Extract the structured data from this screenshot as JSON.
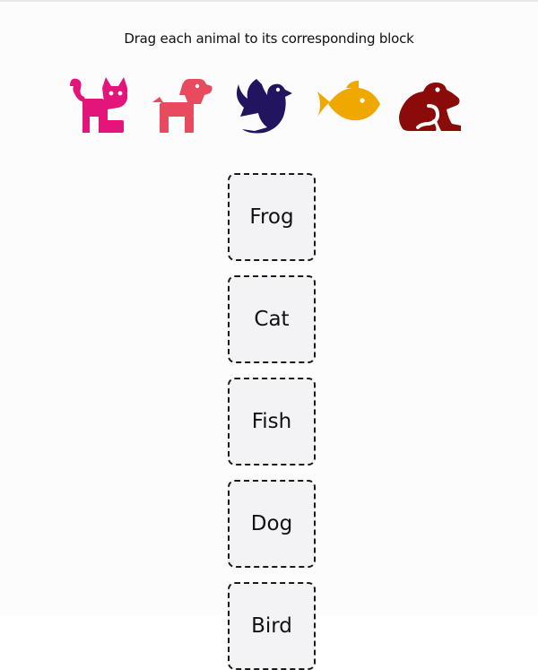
{
  "instruction": "Drag each animal to its corresponding block",
  "animals": [
    {
      "icon": "cat-icon",
      "color": "#e3147a"
    },
    {
      "icon": "dog-icon",
      "color": "#e84a5f"
    },
    {
      "icon": "bird-icon",
      "color": "#22145e"
    },
    {
      "icon": "fish-icon",
      "color": "#eea800"
    },
    {
      "icon": "frog-icon",
      "color": "#8b0a0a"
    }
  ],
  "blocks": [
    {
      "label": "Frog"
    },
    {
      "label": "Cat"
    },
    {
      "label": "Fish"
    },
    {
      "label": "Dog"
    },
    {
      "label": "Bird"
    }
  ]
}
